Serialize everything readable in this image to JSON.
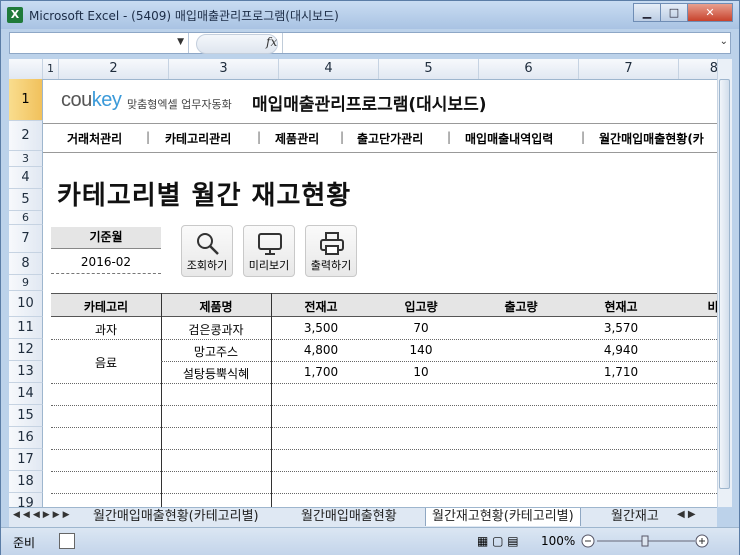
{
  "window": {
    "app_icon": "X",
    "title": "Microsoft Excel - (5409) 매입매출관리프로그램(대시보드)"
  },
  "formula_bar": {
    "fx_label": "fx"
  },
  "columns": [
    "2",
    "3",
    "4",
    "5",
    "6",
    "7",
    "8"
  ],
  "first_col": "1",
  "rows": [
    "1",
    "2",
    "3",
    "4",
    "5",
    "6",
    "7",
    "8",
    "9",
    "10",
    "11",
    "12",
    "13",
    "14",
    "15",
    "16",
    "17",
    "18",
    "19"
  ],
  "brand": {
    "logo_co": "cou",
    "logo_key": "key",
    "tagline": "맞춤형엑셀 업무자동화",
    "app_title": "매입매출관리프로그램(대시보드)"
  },
  "nav": {
    "items": [
      "거래처관리",
      "카테고리관리",
      "제품관리",
      "출고단가관리",
      "매입매출내역입력",
      "월간매입매출현황(카"
    ],
    "separator": "|"
  },
  "heading": "카테고리별 월간 재고현황",
  "base_month": {
    "label": "기준월",
    "value": "2016-02"
  },
  "buttons": {
    "search": "조회하기",
    "preview": "미리보기",
    "print": "출력하기"
  },
  "table": {
    "headers": [
      "카테고리",
      "제품명",
      "전재고",
      "입고량",
      "출고량",
      "현재고",
      "비"
    ],
    "rows": [
      {
        "category": "과자",
        "product": "검은콩과자",
        "prev": "3,500",
        "in": "70",
        "out": "",
        "current": "3,570"
      },
      {
        "category": "음료",
        "product": "망고주스",
        "prev": "4,800",
        "in": "140",
        "out": "",
        "current": "4,940"
      },
      {
        "category": "",
        "product": "설탕등뿍식혜",
        "prev": "1,700",
        "in": "10",
        "out": "",
        "current": "1,710"
      }
    ]
  },
  "sheet_tabs": [
    "월간매입매출현황(카테고리별)",
    "월간매입매출현황",
    "월간재고현황(카테고리별)",
    "월간재고"
  ],
  "status": {
    "ready": "준비",
    "zoom": "100%"
  }
}
